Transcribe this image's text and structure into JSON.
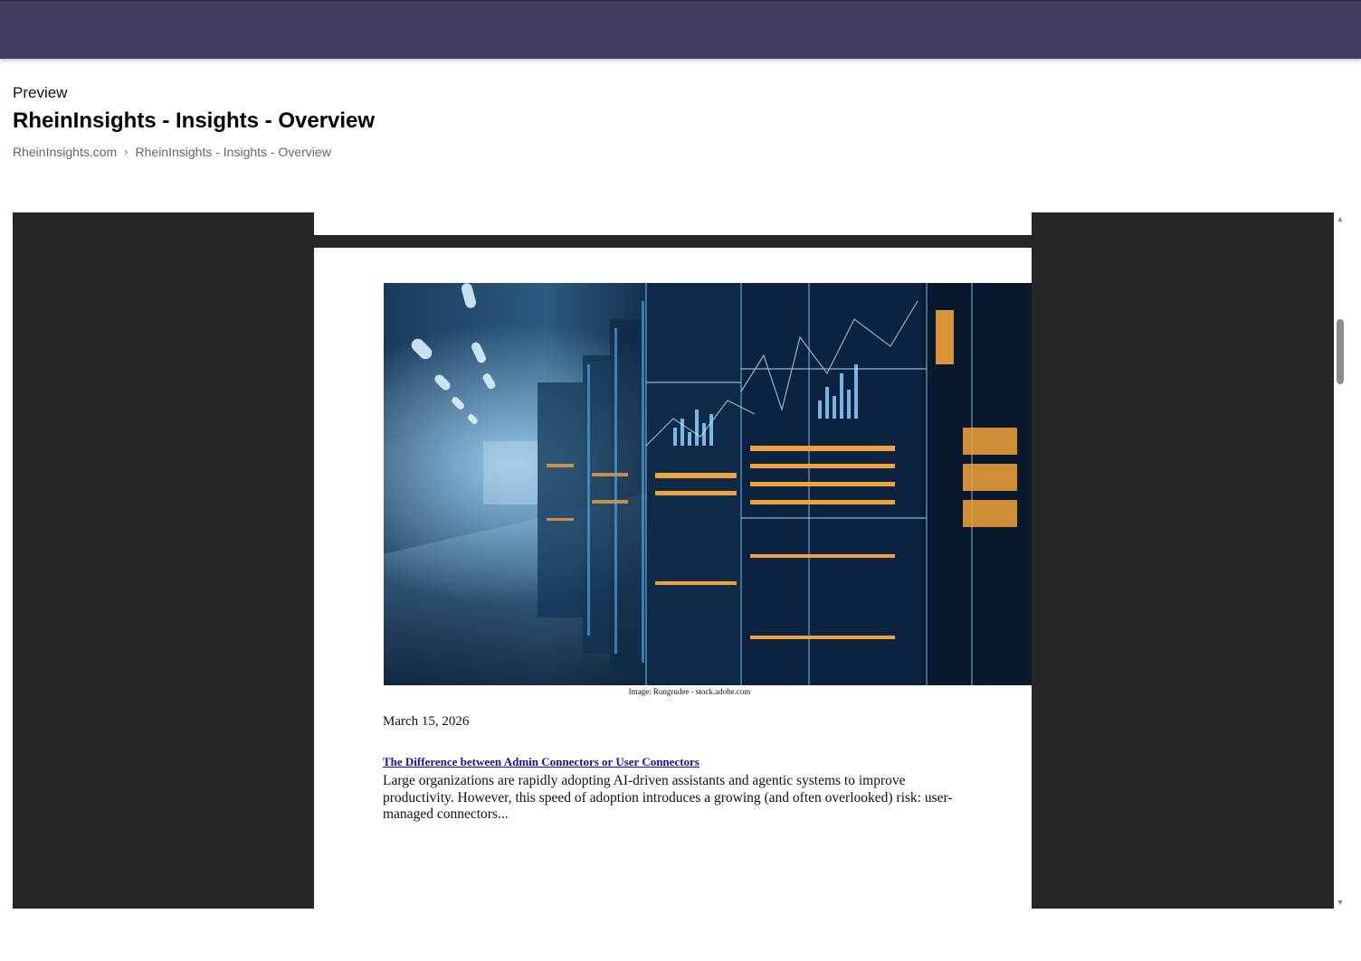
{
  "topbar": {
    "color": "#403d5f"
  },
  "header": {
    "preview_label": "Preview",
    "title": "RheinInsights - Insights - Overview",
    "breadcrumb": {
      "root": "RheinInsights.com",
      "separator": "›",
      "current": "RheinInsights - Insights - Overview"
    }
  },
  "document": {
    "image_subject": "server-room-data-center",
    "image_caption": "Image: Rungrudee - stock.adobe.com",
    "date": "March 15, 2026",
    "article_title": "The Difference between Admin Connectors or User Connectors ",
    "excerpt": "Large organizations are rapidly adopting AI-driven assistants and agentic systems to improve productivity. However, this speed of adoption introduces a growing (and often overlooked) risk: user-managed connectors..."
  },
  "scrollbar": {
    "up_icon": "triangle-up",
    "down_icon": "triangle-down"
  }
}
